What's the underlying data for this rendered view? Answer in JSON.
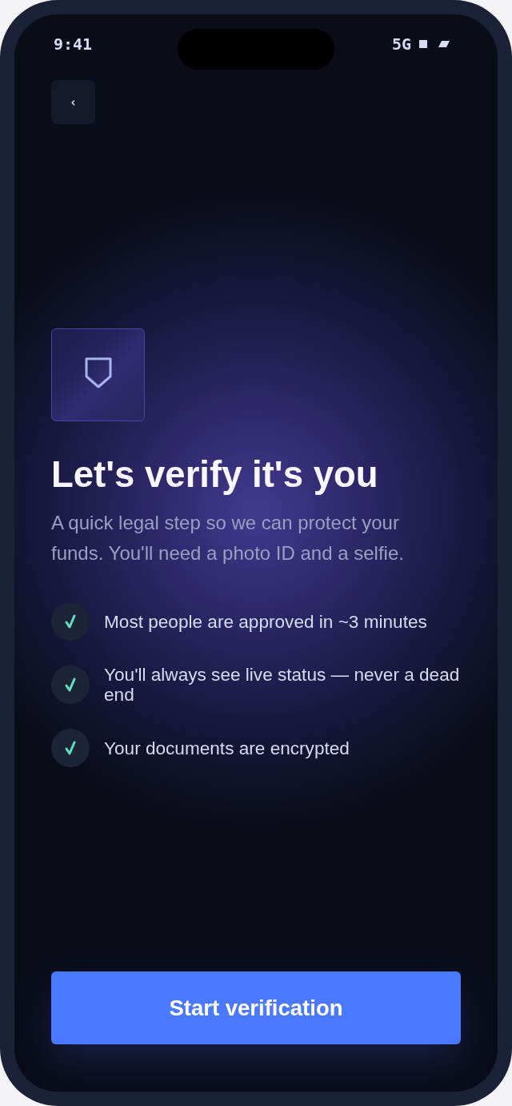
{
  "status_bar": {
    "time": "9:41",
    "network": "5G"
  },
  "back_button": {
    "label": "‹"
  },
  "title": "Let's verify it's you",
  "subtitle": "A quick legal step so we can protect your funds. You'll need a photo ID and a selfie.",
  "checklist": [
    {
      "text": "Most people are approved in ~3 minutes"
    },
    {
      "text": "You'll always see live status — never a dead end"
    },
    {
      "text": "Your documents are encrypted"
    }
  ],
  "primary_button": {
    "label": "Start verification"
  }
}
